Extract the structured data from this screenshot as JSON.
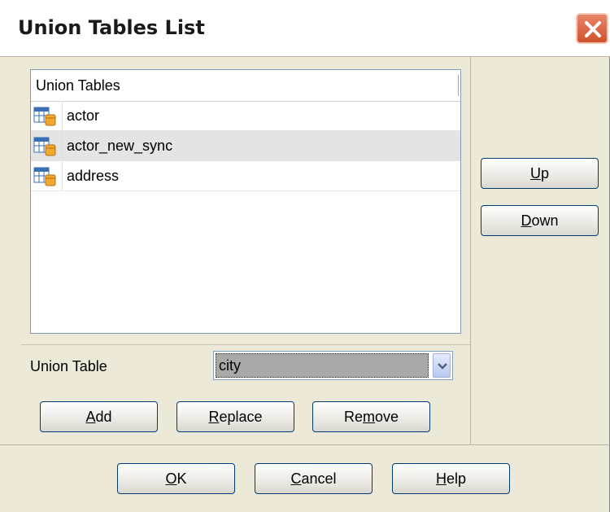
{
  "dialog": {
    "title": "Union Tables List"
  },
  "list": {
    "header": "Union Tables",
    "items": [
      {
        "icon": "table-icon",
        "label": "actor",
        "selected": false
      },
      {
        "icon": "table-icon",
        "label": "actor_new_sync",
        "selected": true
      },
      {
        "icon": "table-icon",
        "label": "address",
        "selected": false
      }
    ]
  },
  "side_buttons": {
    "up": {
      "accel": "U",
      "rest": "p"
    },
    "down": {
      "accel": "D",
      "rest": "own"
    }
  },
  "union_table": {
    "label": "Union Table",
    "value": "city"
  },
  "edit_buttons": {
    "add": {
      "accel": "A",
      "rest": "dd"
    },
    "replace": {
      "accel": "R",
      "rest": "eplace"
    },
    "remove": {
      "pre": "Re",
      "accel": "m",
      "rest": "ove"
    }
  },
  "footer_buttons": {
    "ok": {
      "accel": "O",
      "rest": "K"
    },
    "cancel": {
      "accel": "C",
      "rest": "ancel"
    },
    "help": {
      "accel": "H",
      "rest": "elp"
    }
  },
  "colors": {
    "button_border": "#003c74",
    "close_button": "#d1512e",
    "dialog_bg": "#ece9d8"
  }
}
